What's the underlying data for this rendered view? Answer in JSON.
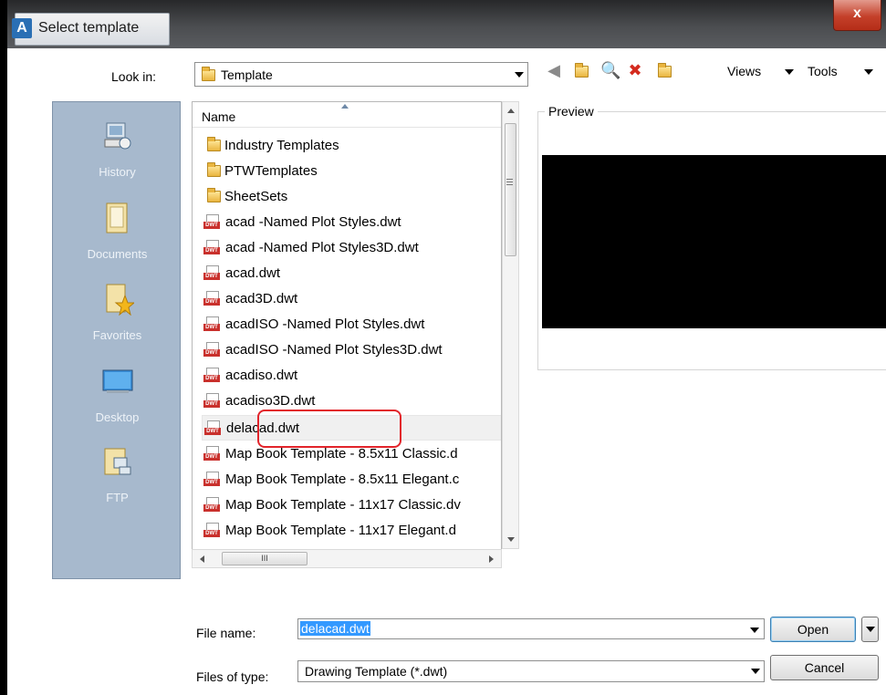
{
  "window": {
    "title": "Select template",
    "app_icon": "A",
    "close_glyph": "x"
  },
  "toolbar": {
    "look_in_label": "Look in:",
    "look_in_value": "Template",
    "back_icon": "back-arrow-icon",
    "views_label": "Views",
    "tools_label": "Tools"
  },
  "places": [
    {
      "label": "History",
      "icon": "history-icon"
    },
    {
      "label": "Documents",
      "icon": "documents-icon"
    },
    {
      "label": "Favorites",
      "icon": "favorites-icon"
    },
    {
      "label": "Desktop",
      "icon": "desktop-icon"
    },
    {
      "label": "FTP",
      "icon": "ftp-icon"
    }
  ],
  "file_list": {
    "column_header": "Name",
    "items": [
      {
        "name": "Industry Templates",
        "type": "folder"
      },
      {
        "name": "PTWTemplates",
        "type": "folder"
      },
      {
        "name": "SheetSets",
        "type": "folder"
      },
      {
        "name": "acad -Named Plot Styles.dwt",
        "type": "dwt"
      },
      {
        "name": "acad -Named Plot Styles3D.dwt",
        "type": "dwt"
      },
      {
        "name": "acad.dwt",
        "type": "dwt"
      },
      {
        "name": "acad3D.dwt",
        "type": "dwt"
      },
      {
        "name": "acadISO -Named Plot Styles.dwt",
        "type": "dwt"
      },
      {
        "name": "acadISO -Named Plot Styles3D.dwt",
        "type": "dwt"
      },
      {
        "name": "acadiso.dwt",
        "type": "dwt"
      },
      {
        "name": "acadiso3D.dwt",
        "type": "dwt"
      },
      {
        "name": "delacad.dwt",
        "type": "dwt",
        "selected": true
      },
      {
        "name": "Map Book Template - 8.5x11 Classic.d",
        "type": "dwt"
      },
      {
        "name": "Map Book Template - 8.5x11 Elegant.c",
        "type": "dwt"
      },
      {
        "name": "Map Book Template - 11x17 Classic.dv",
        "type": "dwt"
      },
      {
        "name": "Map Book Template - 11x17 Elegant.d",
        "type": "dwt"
      }
    ],
    "hscroll_grip": "III"
  },
  "preview": {
    "label": "Preview"
  },
  "form": {
    "file_name_label": "File name:",
    "file_name_value": "delacad.dwt",
    "files_of_type_label": "Files of type:",
    "files_of_type_value": "Drawing Template (*.dwt)",
    "open_label": "Open",
    "cancel_label": "Cancel"
  },
  "icon_text": {
    "dwt_badge": "DWT"
  },
  "colors": {
    "places_bg": "#a7b9cd",
    "highlight_border": "#e2242b",
    "selection_blue": "#3399ff",
    "preview_bg": "#000000"
  }
}
